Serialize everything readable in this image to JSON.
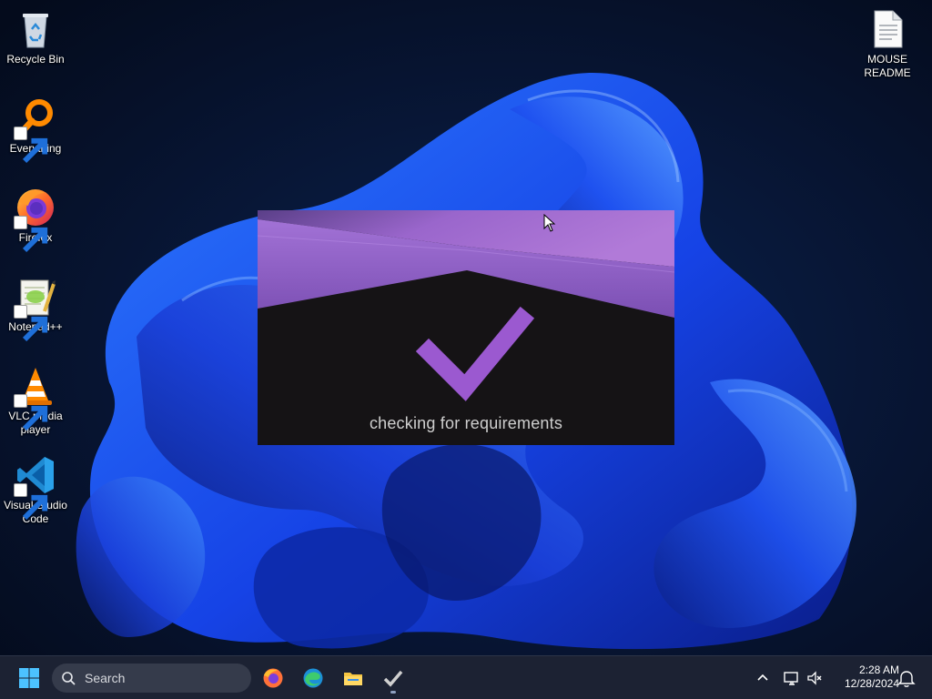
{
  "desktop": {
    "icons_left": [
      {
        "label": "Recycle Bin",
        "icon": "recycle-bin-icon"
      },
      {
        "label": "Everything",
        "icon": "everything-search-icon"
      },
      {
        "label": "Firefox",
        "icon": "firefox-icon"
      },
      {
        "label": "Notepad++",
        "icon": "notepad-plus-plus-icon"
      },
      {
        "label_line1": "VLC media",
        "label_line2": "player",
        "icon": "vlc-icon"
      },
      {
        "label_line1": "Visual Studio",
        "label_line2": "Code",
        "icon": "vscode-icon"
      }
    ],
    "icons_right": [
      {
        "label_line1": "MOUSE",
        "label_line2": "README",
        "icon": "text-document-icon"
      }
    ]
  },
  "splash": {
    "message": "checking for requirements",
    "accent": "#9b59d0"
  },
  "taskbar": {
    "search_label": "Search",
    "pinned": [
      "windows-start-icon",
      "firefox-icon",
      "edge-icon",
      "file-explorer-icon",
      "checkmark-app-icon"
    ],
    "clock_time": "2:28 AM",
    "clock_date": "12/28/2024"
  },
  "colors": {
    "taskbar_bg": "#1c2233",
    "wallpaper_dark": "#061126",
    "wallpaper_blue": "#1e5cff"
  }
}
